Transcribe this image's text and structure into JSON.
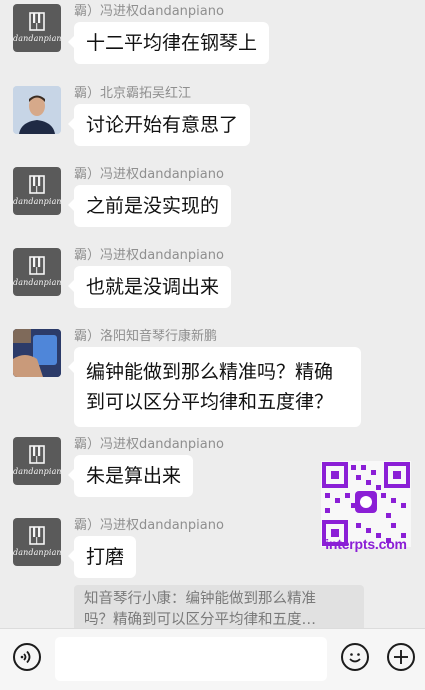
{
  "messages": [
    {
      "sender": "霸）冯进权dandanpiano",
      "text": "十二平均律在钢琴上",
      "avatar": "dandanpiano-logo"
    },
    {
      "sender": "霸）北京霸拓吴红江",
      "text": "讨论开始有意思了",
      "avatar": "person-photo"
    },
    {
      "sender": "霸）冯进权dandanpiano",
      "text": "之前是没实现的",
      "avatar": "dandanpiano-logo"
    },
    {
      "sender": "霸）冯进权dandanpiano",
      "text": "也就是没调出来",
      "avatar": "dandanpiano-logo"
    },
    {
      "sender": "霸）洛阳知音琴行康新鹏",
      "text_line1": "编钟能做到那么精准吗？精确",
      "text_line2": "到可以区分平均律和五度律？",
      "avatar": "hand-photo"
    },
    {
      "sender": "霸）冯进权dandanpiano",
      "text": "朱是算出来",
      "avatar": "dandanpiano-logo"
    },
    {
      "sender": "霸）冯进权dandanpiano",
      "text": "打磨",
      "avatar": "dandanpiano-logo"
    }
  ],
  "logo_text": "dandanpiano",
  "quote": {
    "line1": "知音琴行小康：编钟能做到那么精准",
    "line2": "吗？精确到可以区分平均律和五度…"
  },
  "watermark": {
    "text": "interpts.com",
    "color": "#8b1fd6"
  },
  "input_bar": {
    "voice_icon": "voice-icon",
    "emoji_icon": "emoji-icon",
    "plus_icon": "plus-icon",
    "input_value": ""
  }
}
